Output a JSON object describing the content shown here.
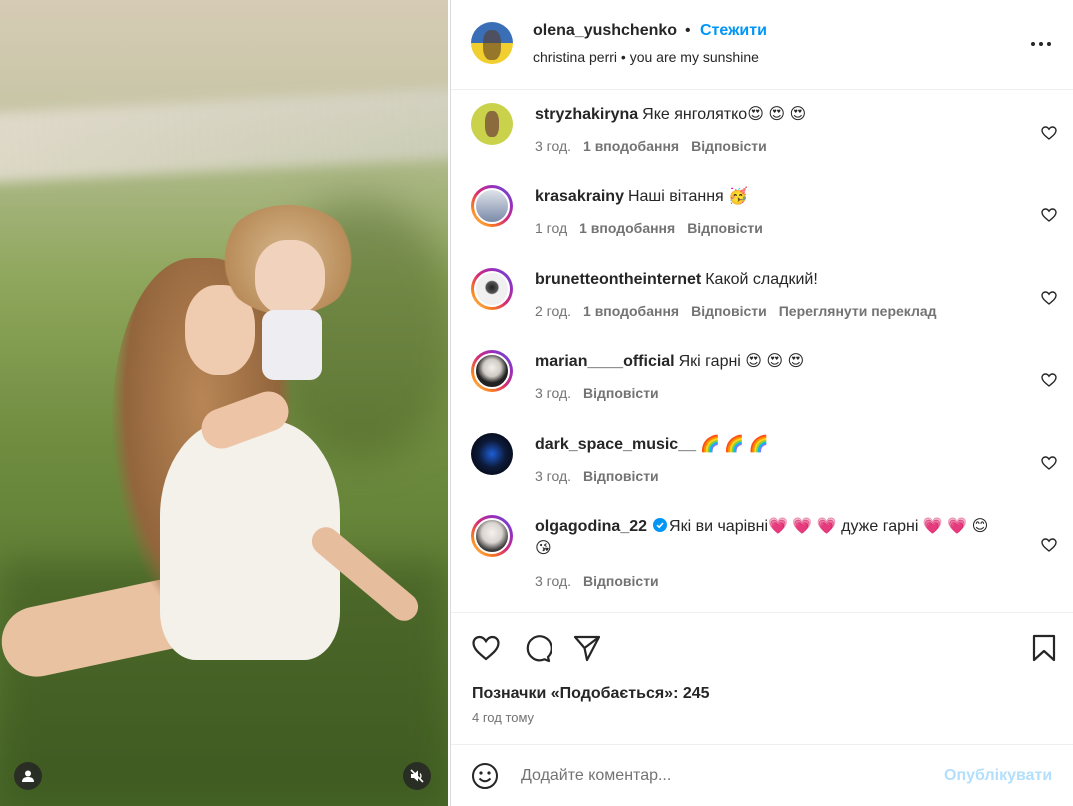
{
  "post": {
    "username": "olena_yushchenko",
    "separator": "•",
    "follow_label": "Стежити",
    "audio": "christina perri • you are my sunshine",
    "more_icon": "more-horizontal-icon"
  },
  "comments": [
    {
      "username": "stryzhakiryna",
      "text": "Яке янголятко😍 😍 😍",
      "time": "3 год.",
      "likes": "1 вподобання",
      "reply": "Відповісти",
      "translate": "",
      "avatar_color": "#c9d24a"
    },
    {
      "username": "krasakrainy",
      "text": "Наші вітання 🥳",
      "time": "1 год",
      "likes": "1 вподобання",
      "reply": "Відповісти",
      "translate": "",
      "avatar_color": "#7a8aa8"
    },
    {
      "username": "brunetteontheinternet",
      "text": "Какой сладкий!",
      "time": "2 год.",
      "likes": "1 вподобання",
      "reply": "Відповісти",
      "translate": "Переглянути переклад",
      "avatar_color": "#e6e6e6"
    },
    {
      "username": "marian____official",
      "text": "Які гарні 😍 😍 😍",
      "time": "3 год.",
      "likes": "",
      "reply": "Відповісти",
      "translate": "",
      "avatar_color": "#222222"
    },
    {
      "username": "dark_space_music__",
      "text": "🌈 🌈 🌈",
      "time": "3 год.",
      "likes": "",
      "reply": "Відповісти",
      "translate": "",
      "avatar_color": "#0d1a3a"
    },
    {
      "username": "olgagodina_22",
      "text": "Які ви чарівні💗 💗 💗  дуже гарні 💗 💗 😊 😘",
      "time": "3 год.",
      "likes": "",
      "reply": "Відповісти",
      "translate": "",
      "avatar_color": "#d9d4cf",
      "verified": true
    }
  ],
  "actions": {
    "likes_text": "Позначки «Подобається»: 245",
    "time_ago": "4 год тому"
  },
  "add_comment": {
    "placeholder": "Додайте коментар...",
    "post_label": "Опублікувати"
  },
  "colors": {
    "accent": "#0095f6",
    "post_disabled": "#b2dffc",
    "secondary_text": "#737373"
  }
}
